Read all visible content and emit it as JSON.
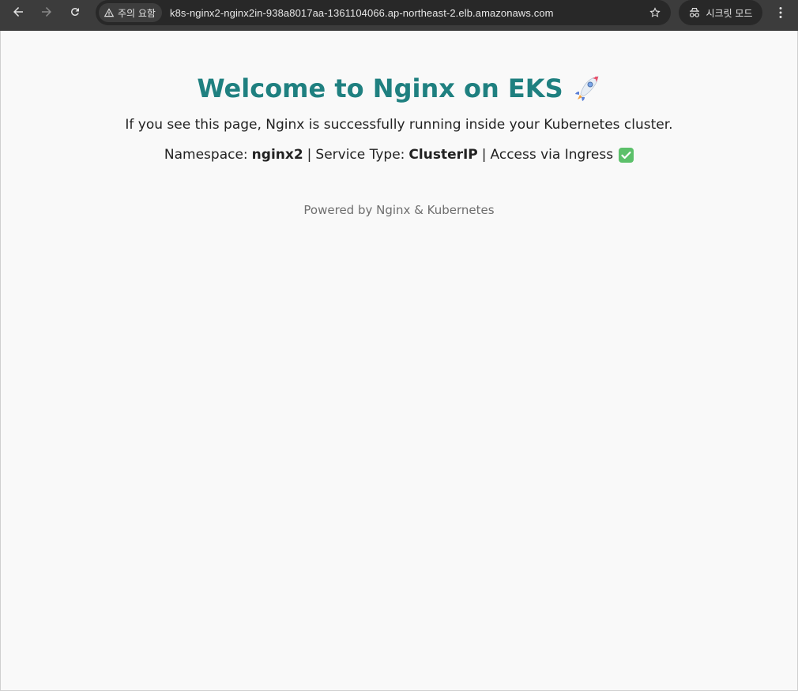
{
  "browser": {
    "security_label": "주의 요함",
    "url": "k8s-nginx2-nginx2in-938a8017aa-1361104066.ap-northeast-2.elb.amazonaws.com",
    "incognito_label": "시크릿 모드"
  },
  "page": {
    "title": "Welcome to Nginx on EKS",
    "description": "If you see this page, Nginx is successfully running inside your Kubernetes cluster.",
    "namespace_label": "Namespace:",
    "namespace_value": "nginx2",
    "separator": "|",
    "service_type_label": "Service Type:",
    "service_type_value": "ClusterIP",
    "access_text": "Access via Ingress",
    "footer": "Powered by Nginx & Kubernetes"
  },
  "icons": {
    "back": "arrow-left-icon",
    "forward": "arrow-right-icon",
    "reload": "reload-icon",
    "warning": "warning-triangle-icon",
    "star": "star-icon",
    "incognito": "incognito-icon",
    "menu": "kebab-menu-icon",
    "rocket": "rocket-emoji",
    "check": "check-mark-emoji"
  },
  "colors": {
    "title": "#1f8080",
    "toolbar": "#3c3c3c",
    "omnibox": "#282828",
    "page_bg": "#f9f9f9",
    "check_bg": "#5cc06a"
  }
}
